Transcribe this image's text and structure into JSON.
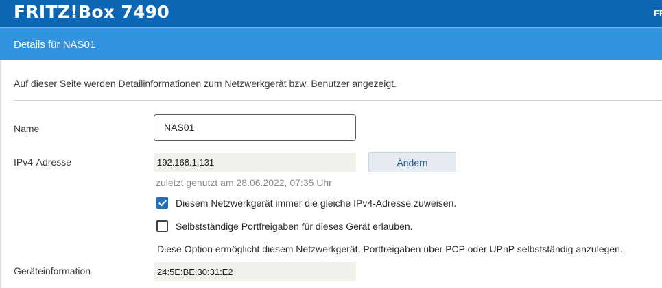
{
  "header": {
    "brand": "FRITZ!Box 7490",
    "right_cut_text": "FRITZ!"
  },
  "subheader": {
    "title": "Details für NAS01"
  },
  "intro": "Auf dieser Seite werden Detailinformationen zum Netzwerkgerät bzw. Benutzer angezeigt.",
  "form": {
    "name_label": "Name",
    "name_value": "NAS01",
    "ipv4_label": "IPv4-Adresse",
    "ipv4_value": "192.168.1.131",
    "change_button": "Ändern",
    "last_used": "zuletzt genutzt am 28.06.2022, 07:35 Uhr",
    "same_ip_label": "Diesem Netzwerkgerät immer die gleiche IPv4-Adresse zuweisen.",
    "same_ip_checked": true,
    "portfw_label": "Selbstständige Portfreigaben für dieses Gerät erlauben.",
    "portfw_checked": false,
    "portfw_note": "Diese Option ermöglicht diesem Netzwerkgerät, Portfreigaben über PCP oder UPnP selbstständig anzulegen.",
    "device_info_label": "Geräteinformation",
    "device_info_value": "24:5E:BE:30:31:E2"
  },
  "colors": {
    "topbar": "#0b66b3",
    "subbar": "#3293e1",
    "checkbox_on": "#1d6fc4",
    "button_text": "#1f5a97"
  }
}
